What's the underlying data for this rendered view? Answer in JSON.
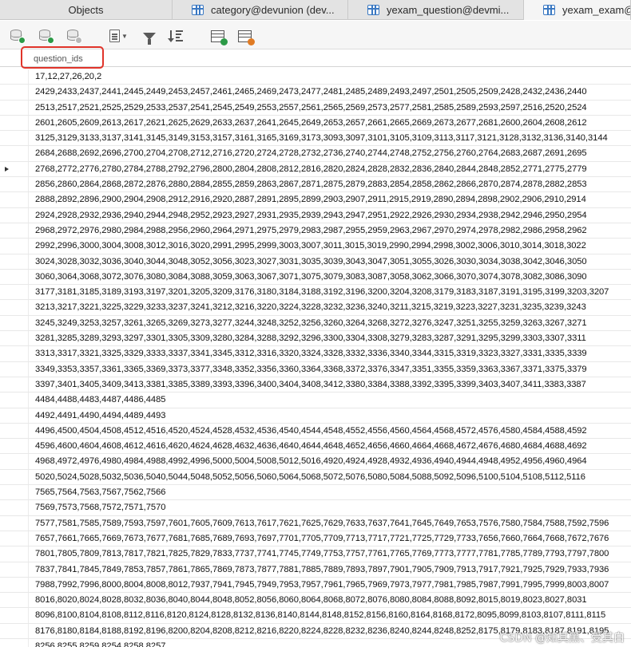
{
  "tabs": [
    {
      "label": "Objects",
      "icon": null
    },
    {
      "label": "category@devunion (dev...",
      "icon": "table-icon"
    },
    {
      "label": "yexam_question@devmi...",
      "icon": "table-icon"
    },
    {
      "label": "yexam_exam@dev",
      "icon": "table-icon"
    }
  ],
  "toolbar": {
    "icons": [
      "add-record-icon",
      "apply-changes-icon",
      "discard-changes-icon",
      "text-view-icon",
      "filter-icon",
      "sort-icon",
      "import-icon",
      "export-icon"
    ]
  },
  "grid": {
    "column": "question_ids",
    "current_row_index": 6,
    "rows": [
      "17,12,27,26,20,2",
      "2429,2433,2437,2441,2445,2449,2453,2457,2461,2465,2469,2473,2477,2481,2485,2489,2493,2497,2501,2505,2509,2428,2432,2436,2440",
      "2513,2517,2521,2525,2529,2533,2537,2541,2545,2549,2553,2557,2561,2565,2569,2573,2577,2581,2585,2589,2593,2597,2516,2520,2524",
      "2601,2605,2609,2613,2617,2621,2625,2629,2633,2637,2641,2645,2649,2653,2657,2661,2665,2669,2673,2677,2681,2600,2604,2608,2612",
      "3125,3129,3133,3137,3141,3145,3149,3153,3157,3161,3165,3169,3173,3093,3097,3101,3105,3109,3113,3117,3121,3128,3132,3136,3140,3144",
      "2684,2688,2692,2696,2700,2704,2708,2712,2716,2720,2724,2728,2732,2736,2740,2744,2748,2752,2756,2760,2764,2683,2687,2691,2695",
      "2768,2772,2776,2780,2784,2788,2792,2796,2800,2804,2808,2812,2816,2820,2824,2828,2832,2836,2840,2844,2848,2852,2771,2775,2779",
      "2856,2860,2864,2868,2872,2876,2880,2884,2855,2859,2863,2867,2871,2875,2879,2883,2854,2858,2862,2866,2870,2874,2878,2882,2853",
      "2888,2892,2896,2900,2904,2908,2912,2916,2920,2887,2891,2895,2899,2903,2907,2911,2915,2919,2890,2894,2898,2902,2906,2910,2914",
      "2924,2928,2932,2936,2940,2944,2948,2952,2923,2927,2931,2935,2939,2943,2947,2951,2922,2926,2930,2934,2938,2942,2946,2950,2954",
      "2968,2972,2976,2980,2984,2988,2956,2960,2964,2971,2975,2979,2983,2987,2955,2959,2963,2967,2970,2974,2978,2982,2986,2958,2962",
      "2992,2996,3000,3004,3008,3012,3016,3020,2991,2995,2999,3003,3007,3011,3015,3019,2990,2994,2998,3002,3006,3010,3014,3018,3022",
      "3024,3028,3032,3036,3040,3044,3048,3052,3056,3023,3027,3031,3035,3039,3043,3047,3051,3055,3026,3030,3034,3038,3042,3046,3050",
      "3060,3064,3068,3072,3076,3080,3084,3088,3059,3063,3067,3071,3075,3079,3083,3087,3058,3062,3066,3070,3074,3078,3082,3086,3090",
      "3177,3181,3185,3189,3193,3197,3201,3205,3209,3176,3180,3184,3188,3192,3196,3200,3204,3208,3179,3183,3187,3191,3195,3199,3203,3207",
      "3213,3217,3221,3225,3229,3233,3237,3241,3212,3216,3220,3224,3228,3232,3236,3240,3211,3215,3219,3223,3227,3231,3235,3239,3243",
      "3245,3249,3253,3257,3261,3265,3269,3273,3277,3244,3248,3252,3256,3260,3264,3268,3272,3276,3247,3251,3255,3259,3263,3267,3271",
      "3281,3285,3289,3293,3297,3301,3305,3309,3280,3284,3288,3292,3296,3300,3304,3308,3279,3283,3287,3291,3295,3299,3303,3307,3311",
      "3313,3317,3321,3325,3329,3333,3337,3341,3345,3312,3316,3320,3324,3328,3332,3336,3340,3344,3315,3319,3323,3327,3331,3335,3339",
      "3349,3353,3357,3361,3365,3369,3373,3377,3348,3352,3356,3360,3364,3368,3372,3376,3347,3351,3355,3359,3363,3367,3371,3375,3379",
      "3397,3401,3405,3409,3413,3381,3385,3389,3393,3396,3400,3404,3408,3412,3380,3384,3388,3392,3395,3399,3403,3407,3411,3383,3387",
      "4484,4488,4483,4487,4486,4485",
      "4492,4491,4490,4494,4489,4493",
      "4496,4500,4504,4508,4512,4516,4520,4524,4528,4532,4536,4540,4544,4548,4552,4556,4560,4564,4568,4572,4576,4580,4584,4588,4592",
      "4596,4600,4604,4608,4612,4616,4620,4624,4628,4632,4636,4640,4644,4648,4652,4656,4660,4664,4668,4672,4676,4680,4684,4688,4692",
      "4968,4972,4976,4980,4984,4988,4992,4996,5000,5004,5008,5012,5016,4920,4924,4928,4932,4936,4940,4944,4948,4952,4956,4960,4964",
      "5020,5024,5028,5032,5036,5040,5044,5048,5052,5056,5060,5064,5068,5072,5076,5080,5084,5088,5092,5096,5100,5104,5108,5112,5116",
      "7565,7564,7563,7567,7562,7566",
      "7569,7573,7568,7572,7571,7570",
      "7577,7581,7585,7589,7593,7597,7601,7605,7609,7613,7617,7621,7625,7629,7633,7637,7641,7645,7649,7653,7576,7580,7584,7588,7592,7596",
      "7657,7661,7665,7669,7673,7677,7681,7685,7689,7693,7697,7701,7705,7709,7713,7717,7721,7725,7729,7733,7656,7660,7664,7668,7672,7676",
      "7801,7805,7809,7813,7817,7821,7825,7829,7833,7737,7741,7745,7749,7753,7757,7761,7765,7769,7773,7777,7781,7785,7789,7793,7797,7800",
      "7837,7841,7845,7849,7853,7857,7861,7865,7869,7873,7877,7881,7885,7889,7893,7897,7901,7905,7909,7913,7917,7921,7925,7929,7933,7936",
      "7988,7992,7996,8000,8004,8008,8012,7937,7941,7945,7949,7953,7957,7961,7965,7969,7973,7977,7981,7985,7987,7991,7995,7999,8003,8007",
      "8016,8020,8024,8028,8032,8036,8040,8044,8048,8052,8056,8060,8064,8068,8072,8076,8080,8084,8088,8092,8015,8019,8023,8027,8031",
      "8096,8100,8104,8108,8112,8116,8120,8124,8128,8132,8136,8140,8144,8148,8152,8156,8160,8164,8168,8172,8095,8099,8103,8107,8111,8115",
      "8176,8180,8184,8188,8192,8196,8200,8204,8208,8212,8216,8220,8224,8228,8232,8236,8240,8244,8248,8252,8175,8179,8183,8187,8191,8195",
      "8256,8255,8259,8254,8258,8257"
    ]
  },
  "watermark": "CSDN @知其黑、受其白",
  "colors": {
    "highlight_box": "#e0342a",
    "tab_icon": "#3a78c2",
    "status_green": "#2c9a47",
    "export_orange": "#e07b24"
  }
}
